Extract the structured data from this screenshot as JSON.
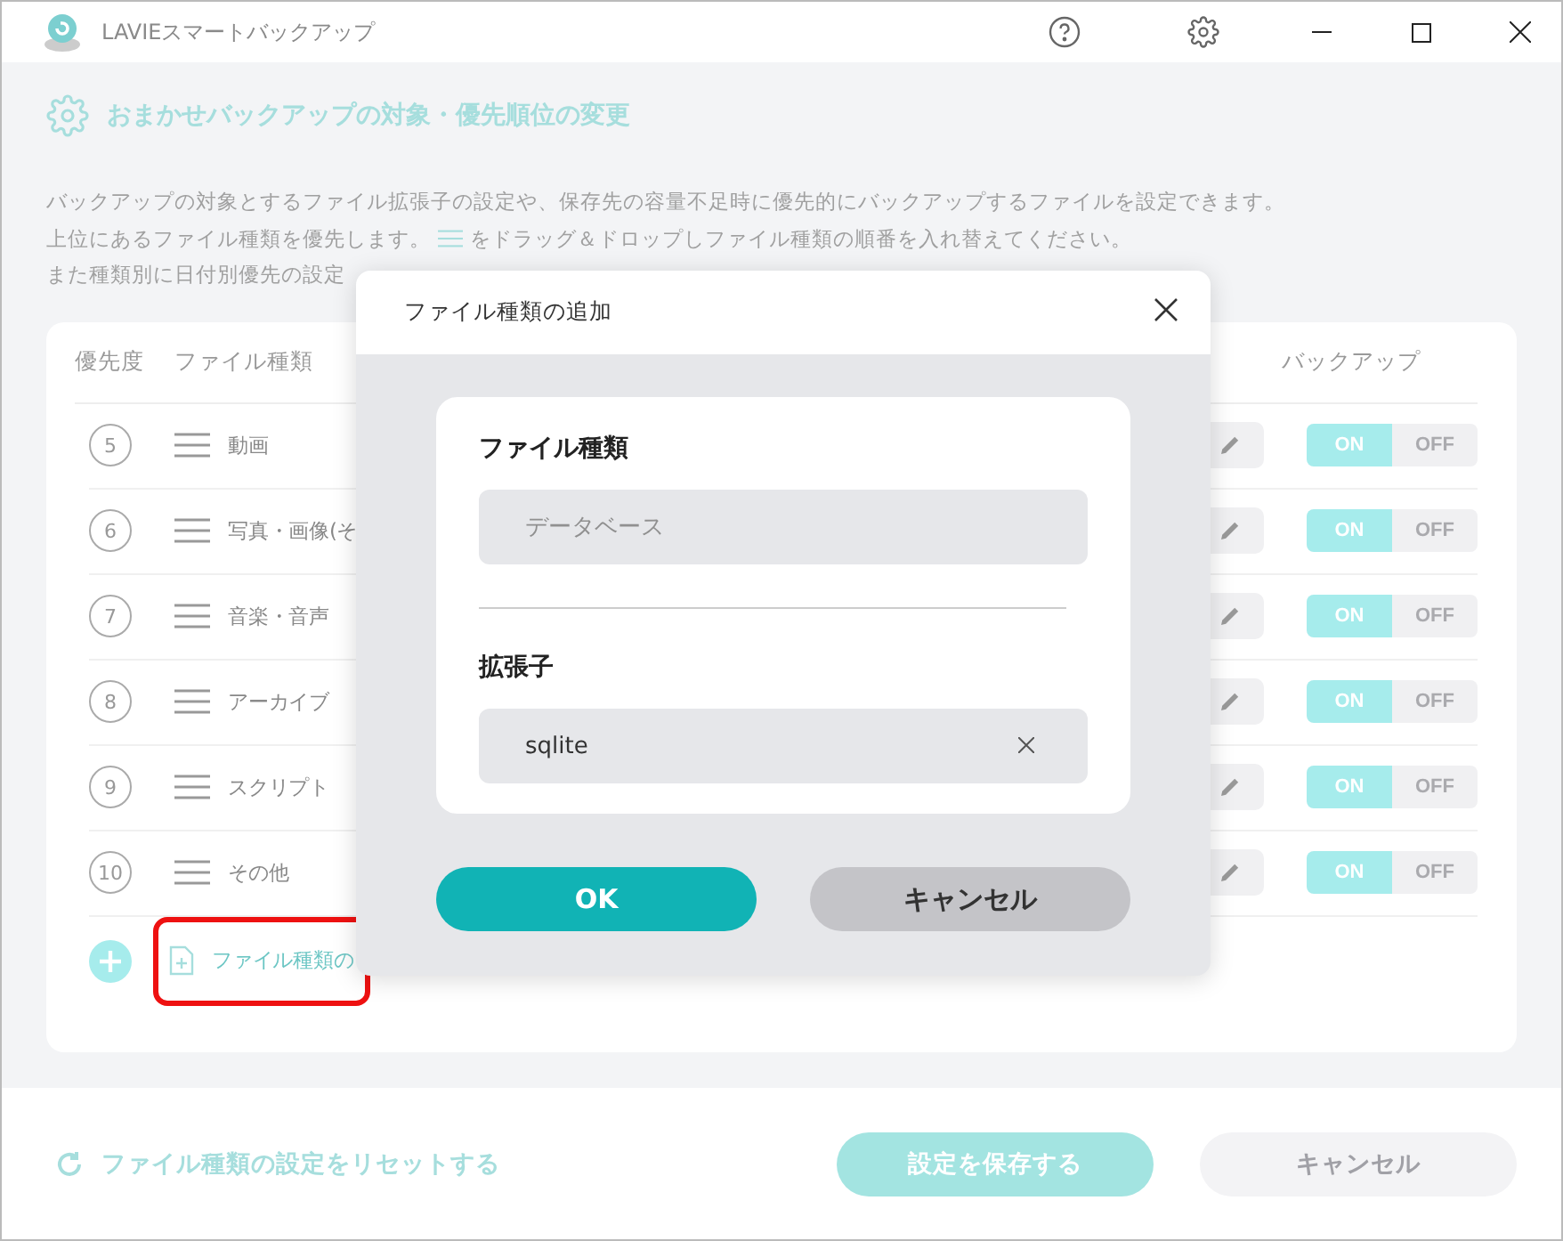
{
  "window": {
    "title": "LAVIEスマートバックアップ"
  },
  "heading": "おまかせバックアップの対象・優先順位の変更",
  "description": [
    "バックアップの対象とするファイル拡張子の設定や、保存先の容量不足時に優先的にバックアップするファイルを設定できます。",
    "上位にあるファイル種類を優先します。",
    "をドラッグ＆ドロップしファイル種類の順番を入れ替えてください。",
    "また種類別に日付別優先の設定"
  ],
  "table": {
    "columns": [
      "優先度",
      "ファイル種類",
      "バックアップ"
    ],
    "rows": [
      {
        "priority": "5",
        "name": "動画",
        "backup_on": true,
        "on_label": "ON",
        "off_label": "OFF"
      },
      {
        "priority": "6",
        "name": "写真・画像(そ",
        "backup_on": true,
        "on_label": "ON",
        "off_label": "OFF"
      },
      {
        "priority": "7",
        "name": "音楽・音声",
        "backup_on": true,
        "on_label": "ON",
        "off_label": "OFF"
      },
      {
        "priority": "8",
        "name": "アーカイブ",
        "backup_on": true,
        "on_label": "ON",
        "off_label": "OFF"
      },
      {
        "priority": "9",
        "name": "スクリプト",
        "backup_on": true,
        "on_label": "ON",
        "off_label": "OFF"
      },
      {
        "priority": "10",
        "name": "その他",
        "backup_on": true,
        "on_label": "ON",
        "off_label": "OFF"
      }
    ],
    "add_label": "ファイル種類の"
  },
  "footer": {
    "reset": "ファイル種類の設定をリセットする",
    "save": "設定を保存する",
    "cancel": "キャンセル"
  },
  "dialog": {
    "title": "ファイル種類の追加",
    "type_label": "ファイル種類",
    "type_placeholder": "データベース",
    "ext_label": "拡張子",
    "ext_value": "sqlite",
    "ok": "OK",
    "cancel": "キャンセル"
  }
}
